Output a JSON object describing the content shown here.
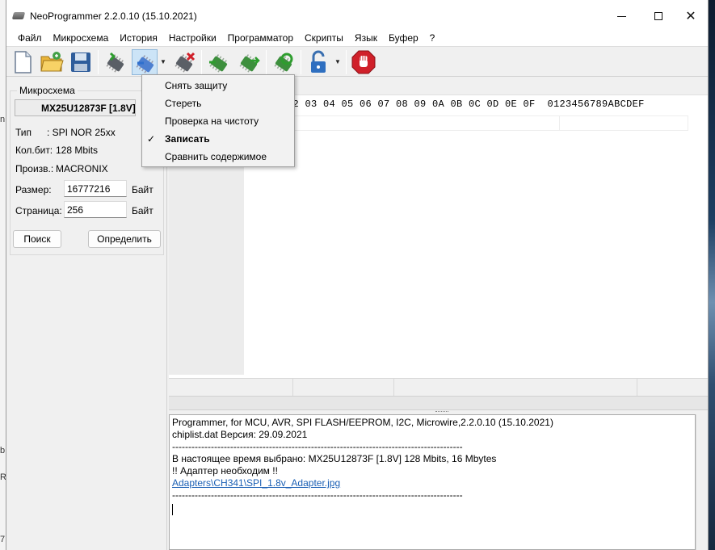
{
  "window": {
    "title": "NeoProgrammer 2.2.0.10 (15.10.2021)",
    "min_glyph": "",
    "max_glyph": "",
    "close_glyph": "✕"
  },
  "menu": [
    "Файл",
    "Микросхема",
    "История",
    "Настройки",
    "Программатор",
    "Скрипты",
    "Язык",
    "Буфер",
    "?"
  ],
  "toolbar": {
    "icons": [
      "new-file-icon",
      "open-folder-icon",
      "save-disk-icon",
      "read-chip-icon",
      "write-chip-icon",
      "erase-chip-icon",
      "verify-chip-icon",
      "auto-chip-icon",
      "blank-check-icon",
      "lock-icon",
      "stop-hand-icon"
    ]
  },
  "dropdown": {
    "items": [
      {
        "label": "Снять защиту",
        "checked": false,
        "bold": false
      },
      {
        "label": "Стереть",
        "checked": false,
        "bold": false
      },
      {
        "label": "Проверка на чистоту",
        "checked": false,
        "bold": false
      },
      {
        "label": "Записать",
        "checked": true,
        "bold": true
      },
      {
        "label": "Сравнить содержимое",
        "checked": false,
        "bold": false
      }
    ],
    "check_glyph": "✓"
  },
  "chip": {
    "group_title": "Микросхема",
    "name": "MX25U12873F [1.8V]",
    "type_label": "Тип",
    "type_value": ":  SPI NOR 25xx",
    "bits_label": "Кол.бит:",
    "bits_value": "128 Mbits",
    "maker_label": "Произв.:",
    "maker_value": "MACRONIX",
    "size_label": "Размер:",
    "size_value": "16777216",
    "size_unit": "Байт",
    "page_label": "Страница:",
    "page_value": "256",
    "page_unit": "Байт",
    "search_button": "Поиск",
    "detect_button": "Определить"
  },
  "hex": {
    "header": "02 03 04 05 06 07 08 09 0A 0B 0C 0D 0E 0F  0123456789ABCDEF"
  },
  "log": {
    "lines": [
      "Programmer, for MCU, AVR, SPI FLASH/EEPROM, I2C, Microwire,2.2.0.10 (15.10.2021)",
      "chiplist.dat Версия: 29.09.2021",
      "------------------------------------------------------------------------------------------",
      "В настоящее время выбрано:  MX25U12873F [1.8V] 128 Mbits, 16 Mbytes",
      "!! Адаптер необходим !!"
    ],
    "link": "Adapters\\CH341\\SPI_1.8v_Adapter.jpg",
    "separator2": "------------------------------------------------------------------------------------------"
  },
  "background": {
    "left_fragments": [
      "n",
      "b",
      "R",
      "7"
    ]
  },
  "colors": {
    "accent_pressed": "#cce4f7",
    "link": "#1a5fb4",
    "stop_red": "#d0202a"
  }
}
